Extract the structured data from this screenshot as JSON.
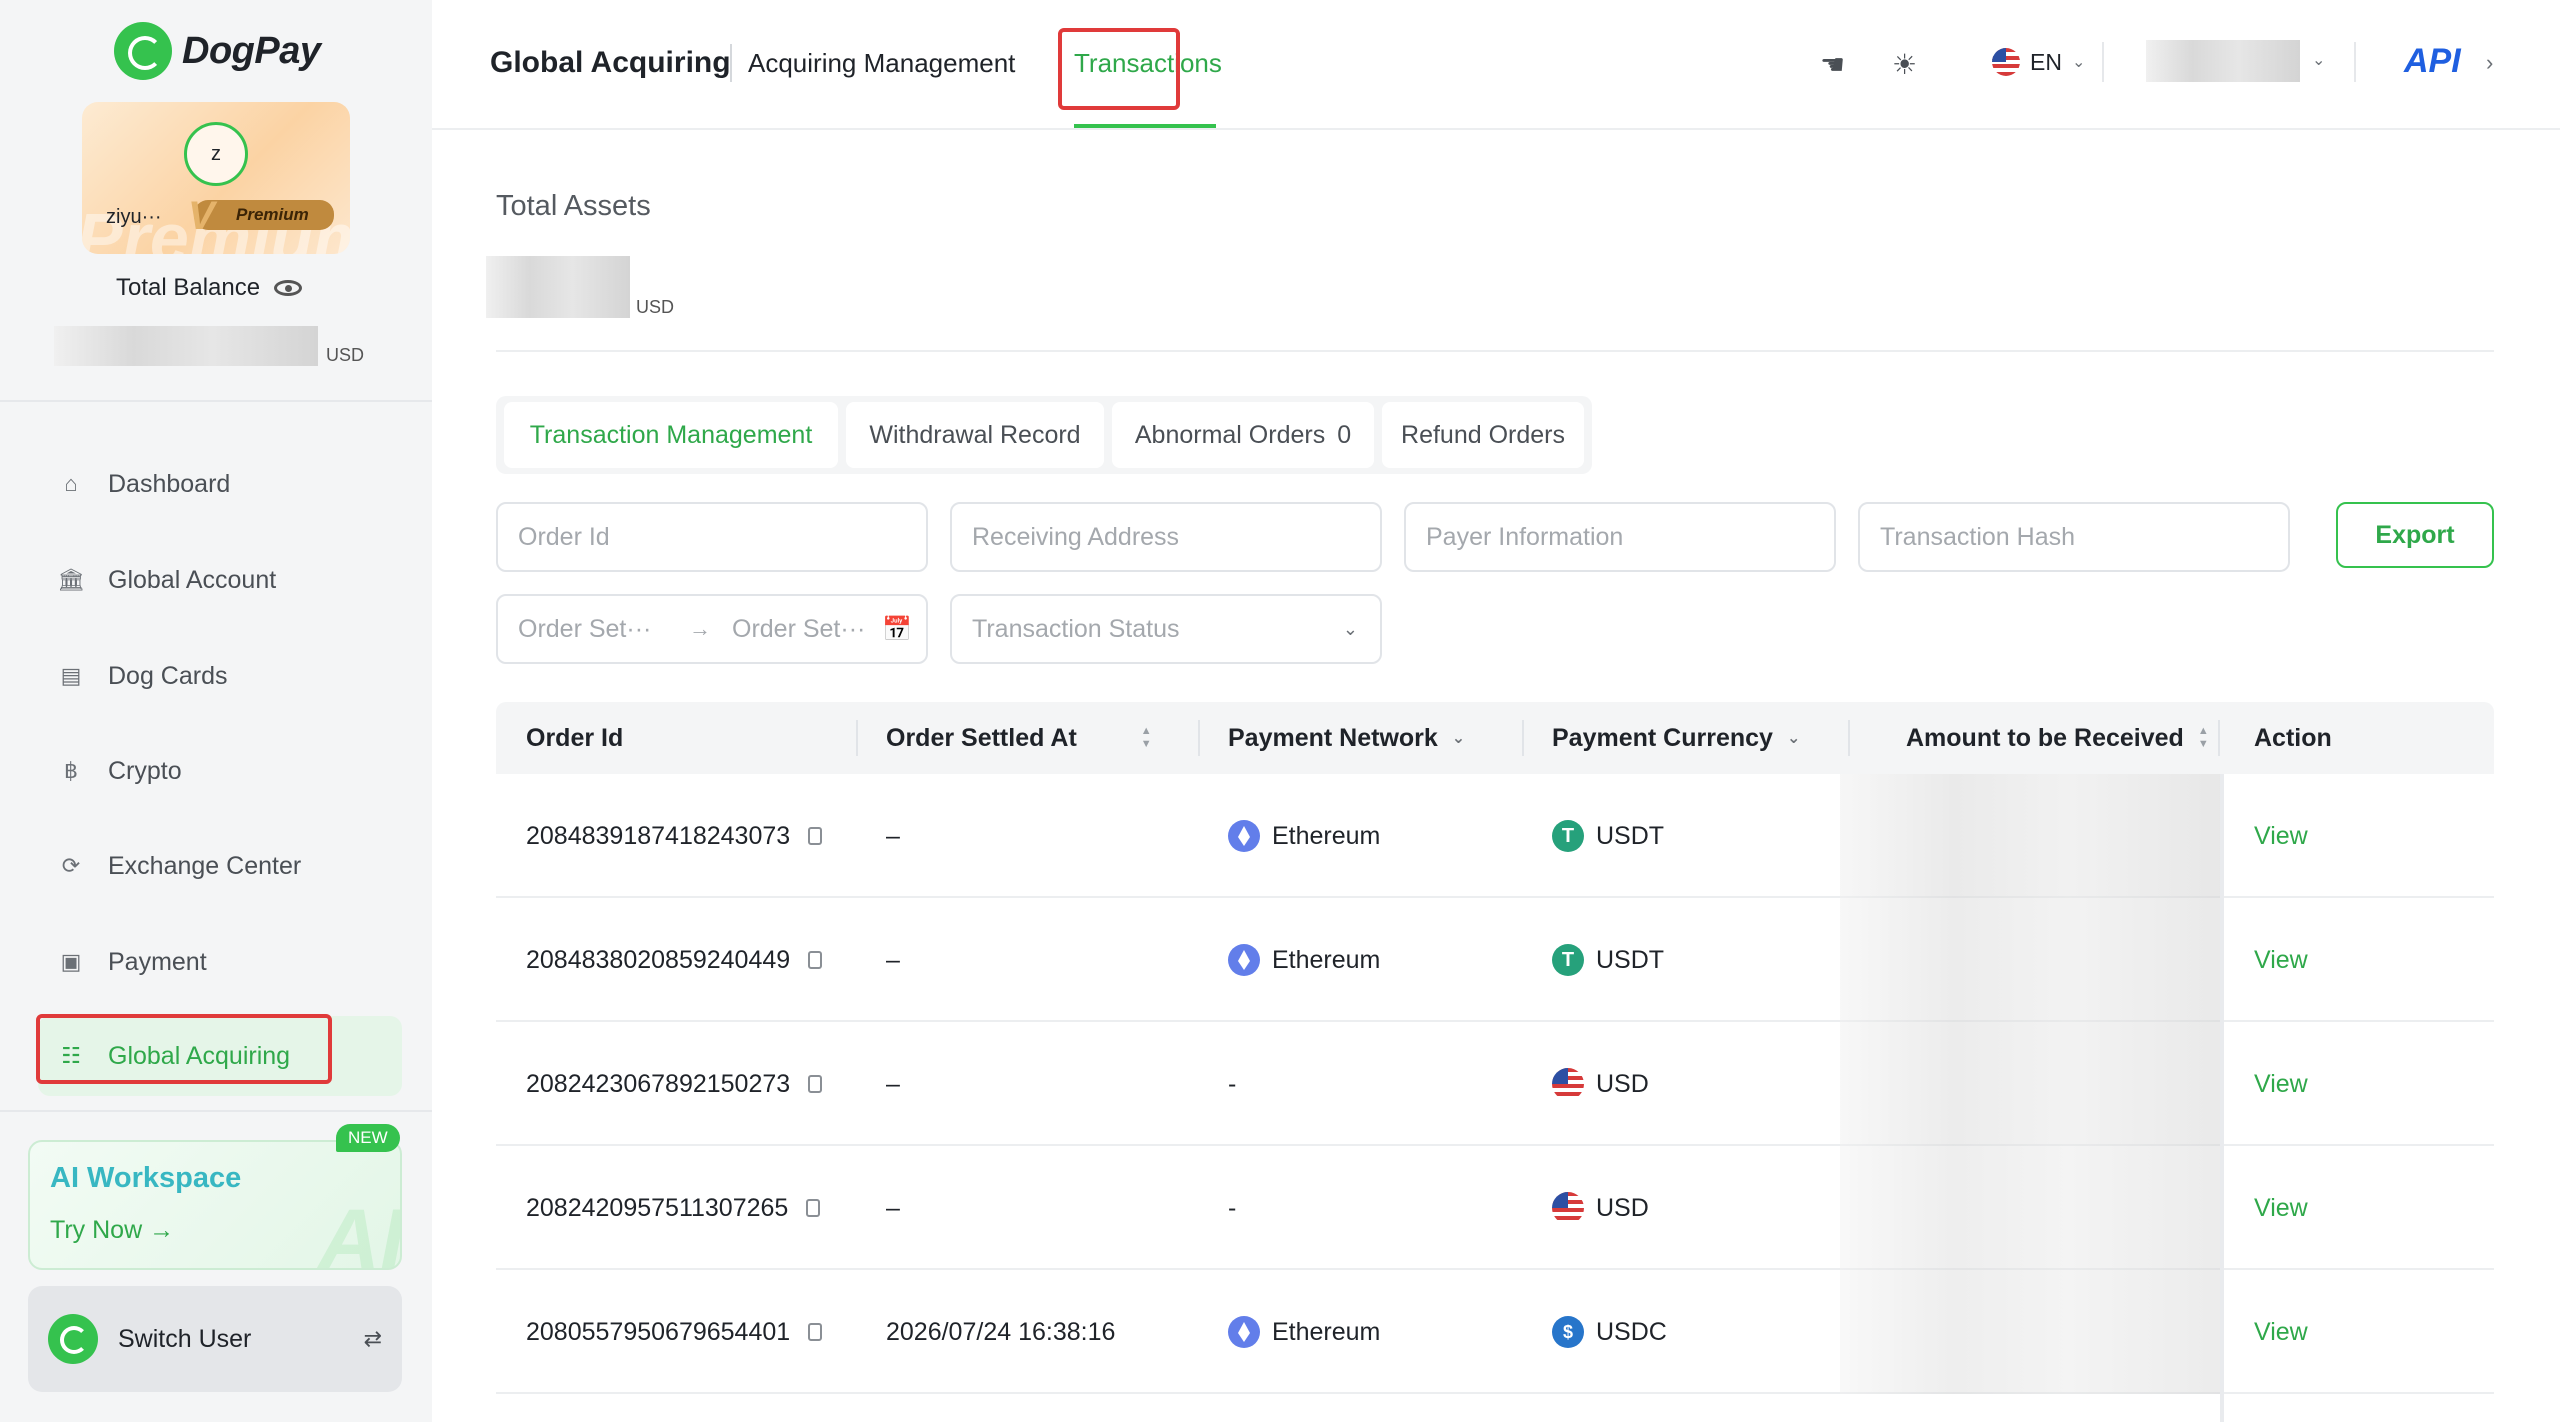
{
  "app": {
    "name": "DogPay"
  },
  "sidebar": {
    "user": {
      "avatar_letter": "z",
      "name": "ziyu···",
      "tier": "Premium",
      "tier_letter": "V"
    },
    "balance": {
      "label": "Total Balance",
      "currency": "USD"
    },
    "nav": [
      {
        "label": "Dashboard",
        "icon": "home-icon"
      },
      {
        "label": "Global Account",
        "icon": "bank-icon"
      },
      {
        "label": "Dog Cards",
        "icon": "card-icon"
      },
      {
        "label": "Crypto",
        "icon": "bitcoin-icon"
      },
      {
        "label": "Exchange Center",
        "icon": "exchange-icon"
      },
      {
        "label": "Payment",
        "icon": "wallet-icon"
      },
      {
        "label": "Global Acquiring",
        "icon": "acquiring-icon",
        "active": true
      }
    ],
    "ai_workspace": {
      "title": "AI Workspace",
      "cta": "Try Now →",
      "badge": "NEW",
      "watermark": "AI"
    },
    "switch_user": {
      "label": "Switch User"
    }
  },
  "header": {
    "breadcrumb_main": "Global Acquiring",
    "breadcrumb_sub": "Acquiring Management",
    "active_tab": "Transactions",
    "language": "EN",
    "api_label": "API"
  },
  "main": {
    "total_assets": {
      "label": "Total Assets",
      "currency": "USD"
    },
    "tabs": [
      {
        "label": "Transaction Management",
        "active": true
      },
      {
        "label": "Withdrawal Record"
      },
      {
        "label": "Abnormal Orders",
        "count": "0"
      },
      {
        "label": "Refund Orders"
      }
    ],
    "filters": {
      "order_id": "Order Id",
      "receiving_address": "Receiving Address",
      "payer_information": "Payer Information",
      "transaction_hash": "Transaction Hash",
      "date_start": "Order Set···",
      "date_end": "Order Set···",
      "transaction_status": "Transaction Status"
    },
    "export_label": "Export"
  },
  "table": {
    "columns": [
      "Order Id",
      "Order Settled At",
      "Payment Network",
      "Payment Currency",
      "Amount to be Received",
      "Action"
    ],
    "rows": [
      {
        "order_id": "2084839187418243073",
        "settled_at": "–",
        "network": "Ethereum",
        "network_icon": "ethereum-icon",
        "currency": "USDT",
        "currency_icon": "usdt-icon",
        "action": "View"
      },
      {
        "order_id": "2084838020859240449",
        "settled_at": "–",
        "network": "Ethereum",
        "network_icon": "ethereum-icon",
        "currency": "USDT",
        "currency_icon": "usdt-icon",
        "action": "View"
      },
      {
        "order_id": "2082423067892150273",
        "settled_at": "–",
        "network": "-",
        "network_icon": "",
        "currency": "USD",
        "currency_icon": "us-flag-icon",
        "action": "View"
      },
      {
        "order_id": "2082420957511307265",
        "settled_at": "–",
        "network": "-",
        "network_icon": "",
        "currency": "USD",
        "currency_icon": "us-flag-icon",
        "action": "View"
      },
      {
        "order_id": "2080557950679654401",
        "settled_at": "2026/07/24 16:38:16",
        "network": "Ethereum",
        "network_icon": "ethereum-icon",
        "currency": "USDC",
        "currency_icon": "usdc-icon",
        "action": "View"
      }
    ]
  },
  "colors": {
    "brand": "#35c24e",
    "accent_text": "#2fa84a",
    "highlight": "#e03a3a",
    "api": "#1f5fe0"
  }
}
